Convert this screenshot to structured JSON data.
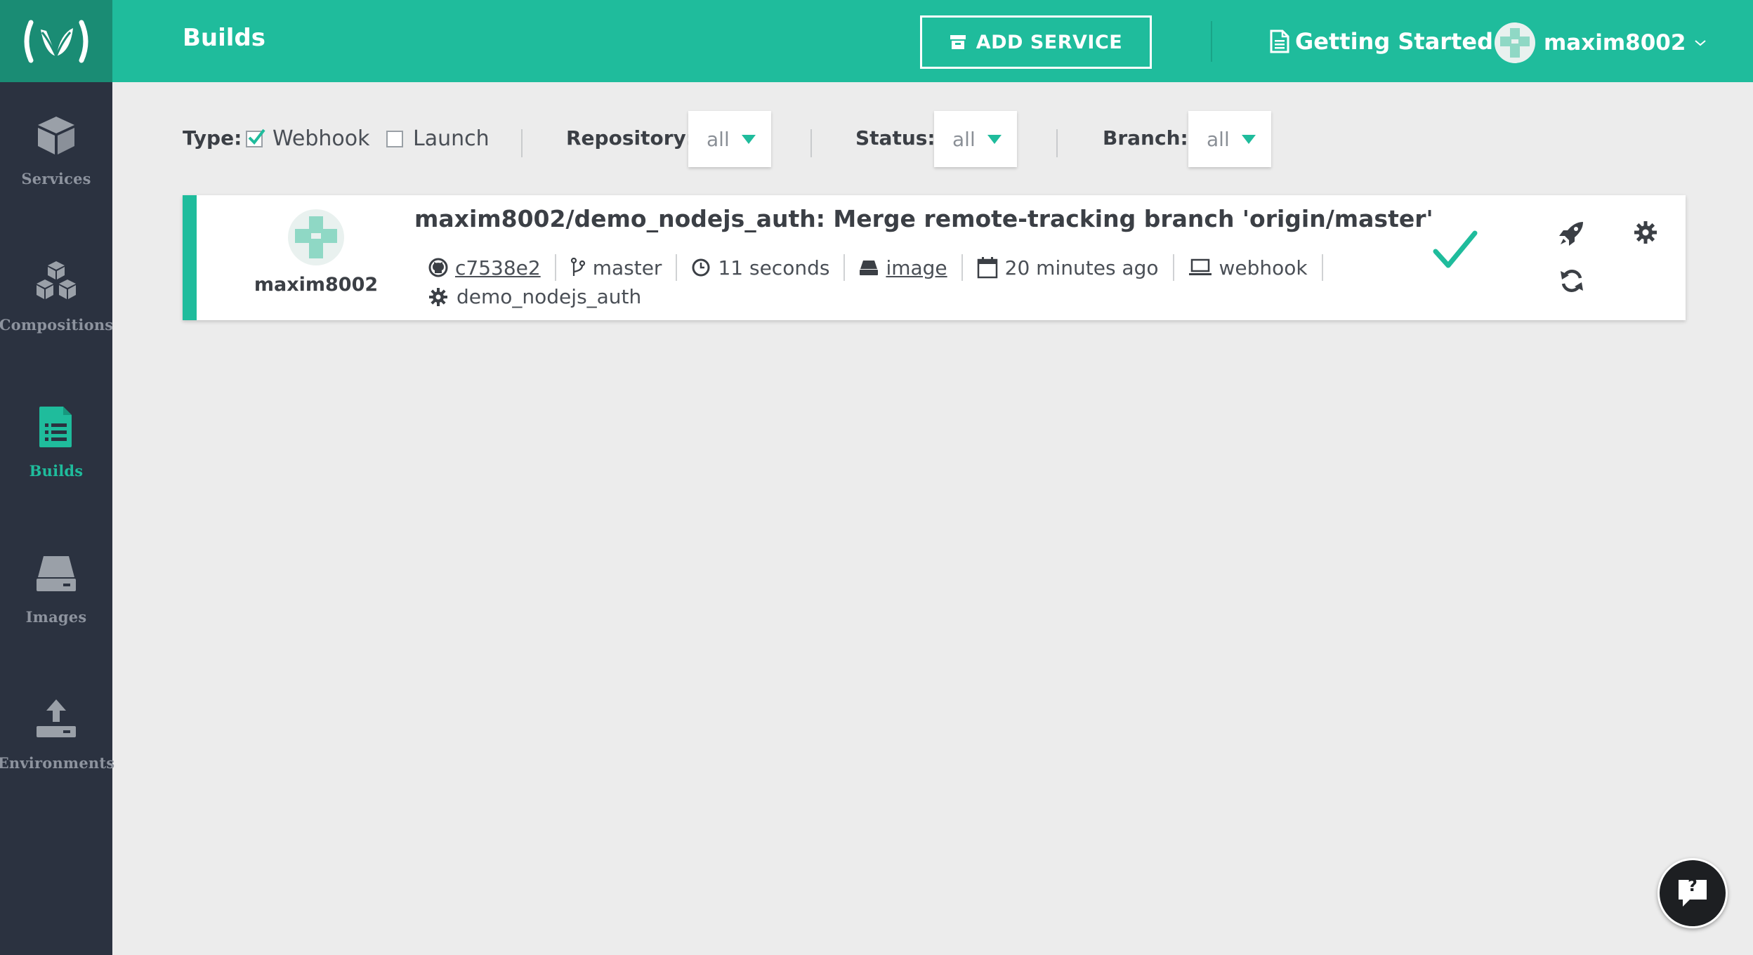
{
  "sidebar": {
    "logo_icon": "codefresh-logo-icon",
    "items": [
      {
        "label": "Services",
        "icon": "cube-icon",
        "active": false
      },
      {
        "label": "Compositions",
        "icon": "cubes-icon",
        "active": false
      },
      {
        "label": "Builds",
        "icon": "document-list-icon",
        "active": true
      },
      {
        "label": "Images",
        "icon": "hard-drive-icon",
        "active": false
      },
      {
        "label": "Environments",
        "icon": "upload-icon",
        "active": false
      }
    ]
  },
  "header": {
    "title": "Builds",
    "add_service_label": "ADD SERVICE",
    "getting_started_label": "Getting Started",
    "username": "maxim8002"
  },
  "filters": {
    "type_label": "Type:",
    "webhook": {
      "label": "Webhook",
      "checked": true
    },
    "launch": {
      "label": "Launch",
      "checked": false
    },
    "repository_label": "Repository:",
    "repository_value": "all",
    "status_label": "Status:",
    "status_value": "all",
    "branch_label": "Branch:",
    "branch_value": "all"
  },
  "builds": [
    {
      "user": "maxim8002",
      "title": "maxim8002/demo_nodejs_auth: Merge remote-tracking branch 'origin/master'",
      "commit": "c7538e2",
      "branch": "master",
      "duration": "11 seconds",
      "image_link": "image",
      "time_ago": "20 minutes ago",
      "trigger": "webhook",
      "service": "demo_nodejs_auth",
      "status": "success"
    }
  ],
  "colors": {
    "accent": "#1fbc9c",
    "sidebar": "#2b3240",
    "logo_bg": "#1a8c74",
    "background": "#ececec"
  },
  "help_label": "?"
}
